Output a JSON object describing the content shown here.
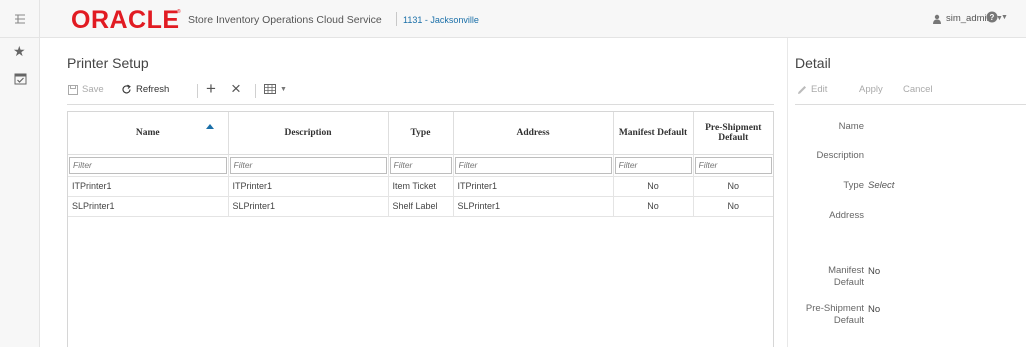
{
  "header": {
    "brand": "ORACLE",
    "trademark": "®",
    "app_title": "Store Inventory Operations Cloud Service",
    "store": "1131 - Jacksonville",
    "user": "sim_admin"
  },
  "main": {
    "title": "Printer Setup",
    "toolbar": {
      "save_label": "Save",
      "refresh_label": "Refresh",
      "add_symbol": "+",
      "delete_symbol": "×"
    },
    "columns": {
      "name": "Name",
      "description": "Description",
      "type": "Type",
      "address": "Address",
      "manifest_default": "Manifest Default",
      "preshipment_default": "Pre-Shipment Default"
    },
    "filter_placeholder": "Filter",
    "rows": [
      {
        "name": "ITPrinter1",
        "description": "ITPrinter1",
        "type": "Item Ticket",
        "address": "ITPrinter1",
        "manifest_default": "No",
        "preshipment_default": "No"
      },
      {
        "name": "SLPrinter1",
        "description": "SLPrinter1",
        "type": "Shelf Label",
        "address": "SLPrinter1",
        "manifest_default": "No",
        "preshipment_default": "No"
      }
    ]
  },
  "detail": {
    "title": "Detail",
    "edit_label": "Edit",
    "apply_label": "Apply",
    "cancel_label": "Cancel",
    "fields": {
      "name_label": "Name",
      "description_label": "Description",
      "type_label": "Type",
      "type_value": "Select",
      "address_label": "Address",
      "manifest_label_1": "Manifest",
      "manifest_label_2": "Default",
      "manifest_value": "No",
      "preshipment_label_1": "Pre-Shipment",
      "preshipment_label_2": "Default",
      "preshipment_value": "No"
    }
  },
  "colors": {
    "brand_red": "#e11b22",
    "link_blue": "#1a6fa8"
  }
}
